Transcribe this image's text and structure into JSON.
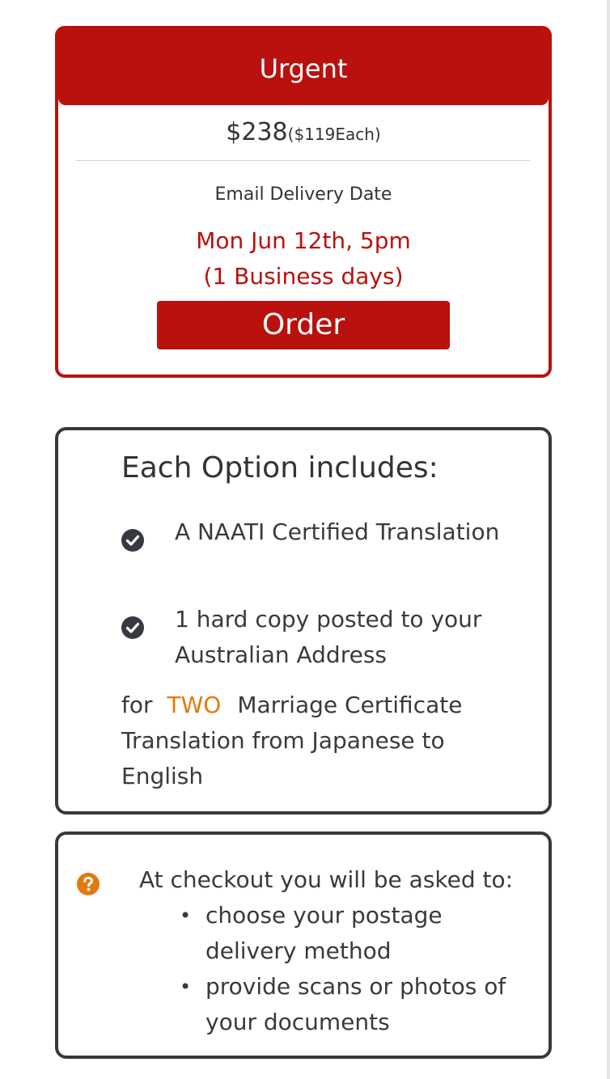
{
  "urgent_card": {
    "title": "Urgent",
    "price": "$238",
    "price_each": "($119Each)",
    "delivery_label": "Email Delivery Date",
    "delivery_date": "Mon Jun 12th, 5pm",
    "business_days": "(1 Business days)",
    "order_label": "Order",
    "accent_color": "#b9110e"
  },
  "includes": {
    "title": "Each Option includes:",
    "items": [
      {
        "icon": "check-circle-icon",
        "text": "A NAATI Certified Translation"
      },
      {
        "icon": "check-circle-icon",
        "text": "1 hard copy posted to your Australian Address"
      }
    ],
    "for_prefix": "for",
    "count_word": "TWO",
    "count_color": "#e2790f",
    "for_suffix": "Marriage Certificate Translation from Japanese to English"
  },
  "checkout": {
    "icon": "question-circle-icon",
    "icon_color": "#e2790f",
    "intro": "At checkout you will be asked to:",
    "bullets": [
      "choose your postage delivery method",
      "provide scans or photos of your documents"
    ]
  }
}
